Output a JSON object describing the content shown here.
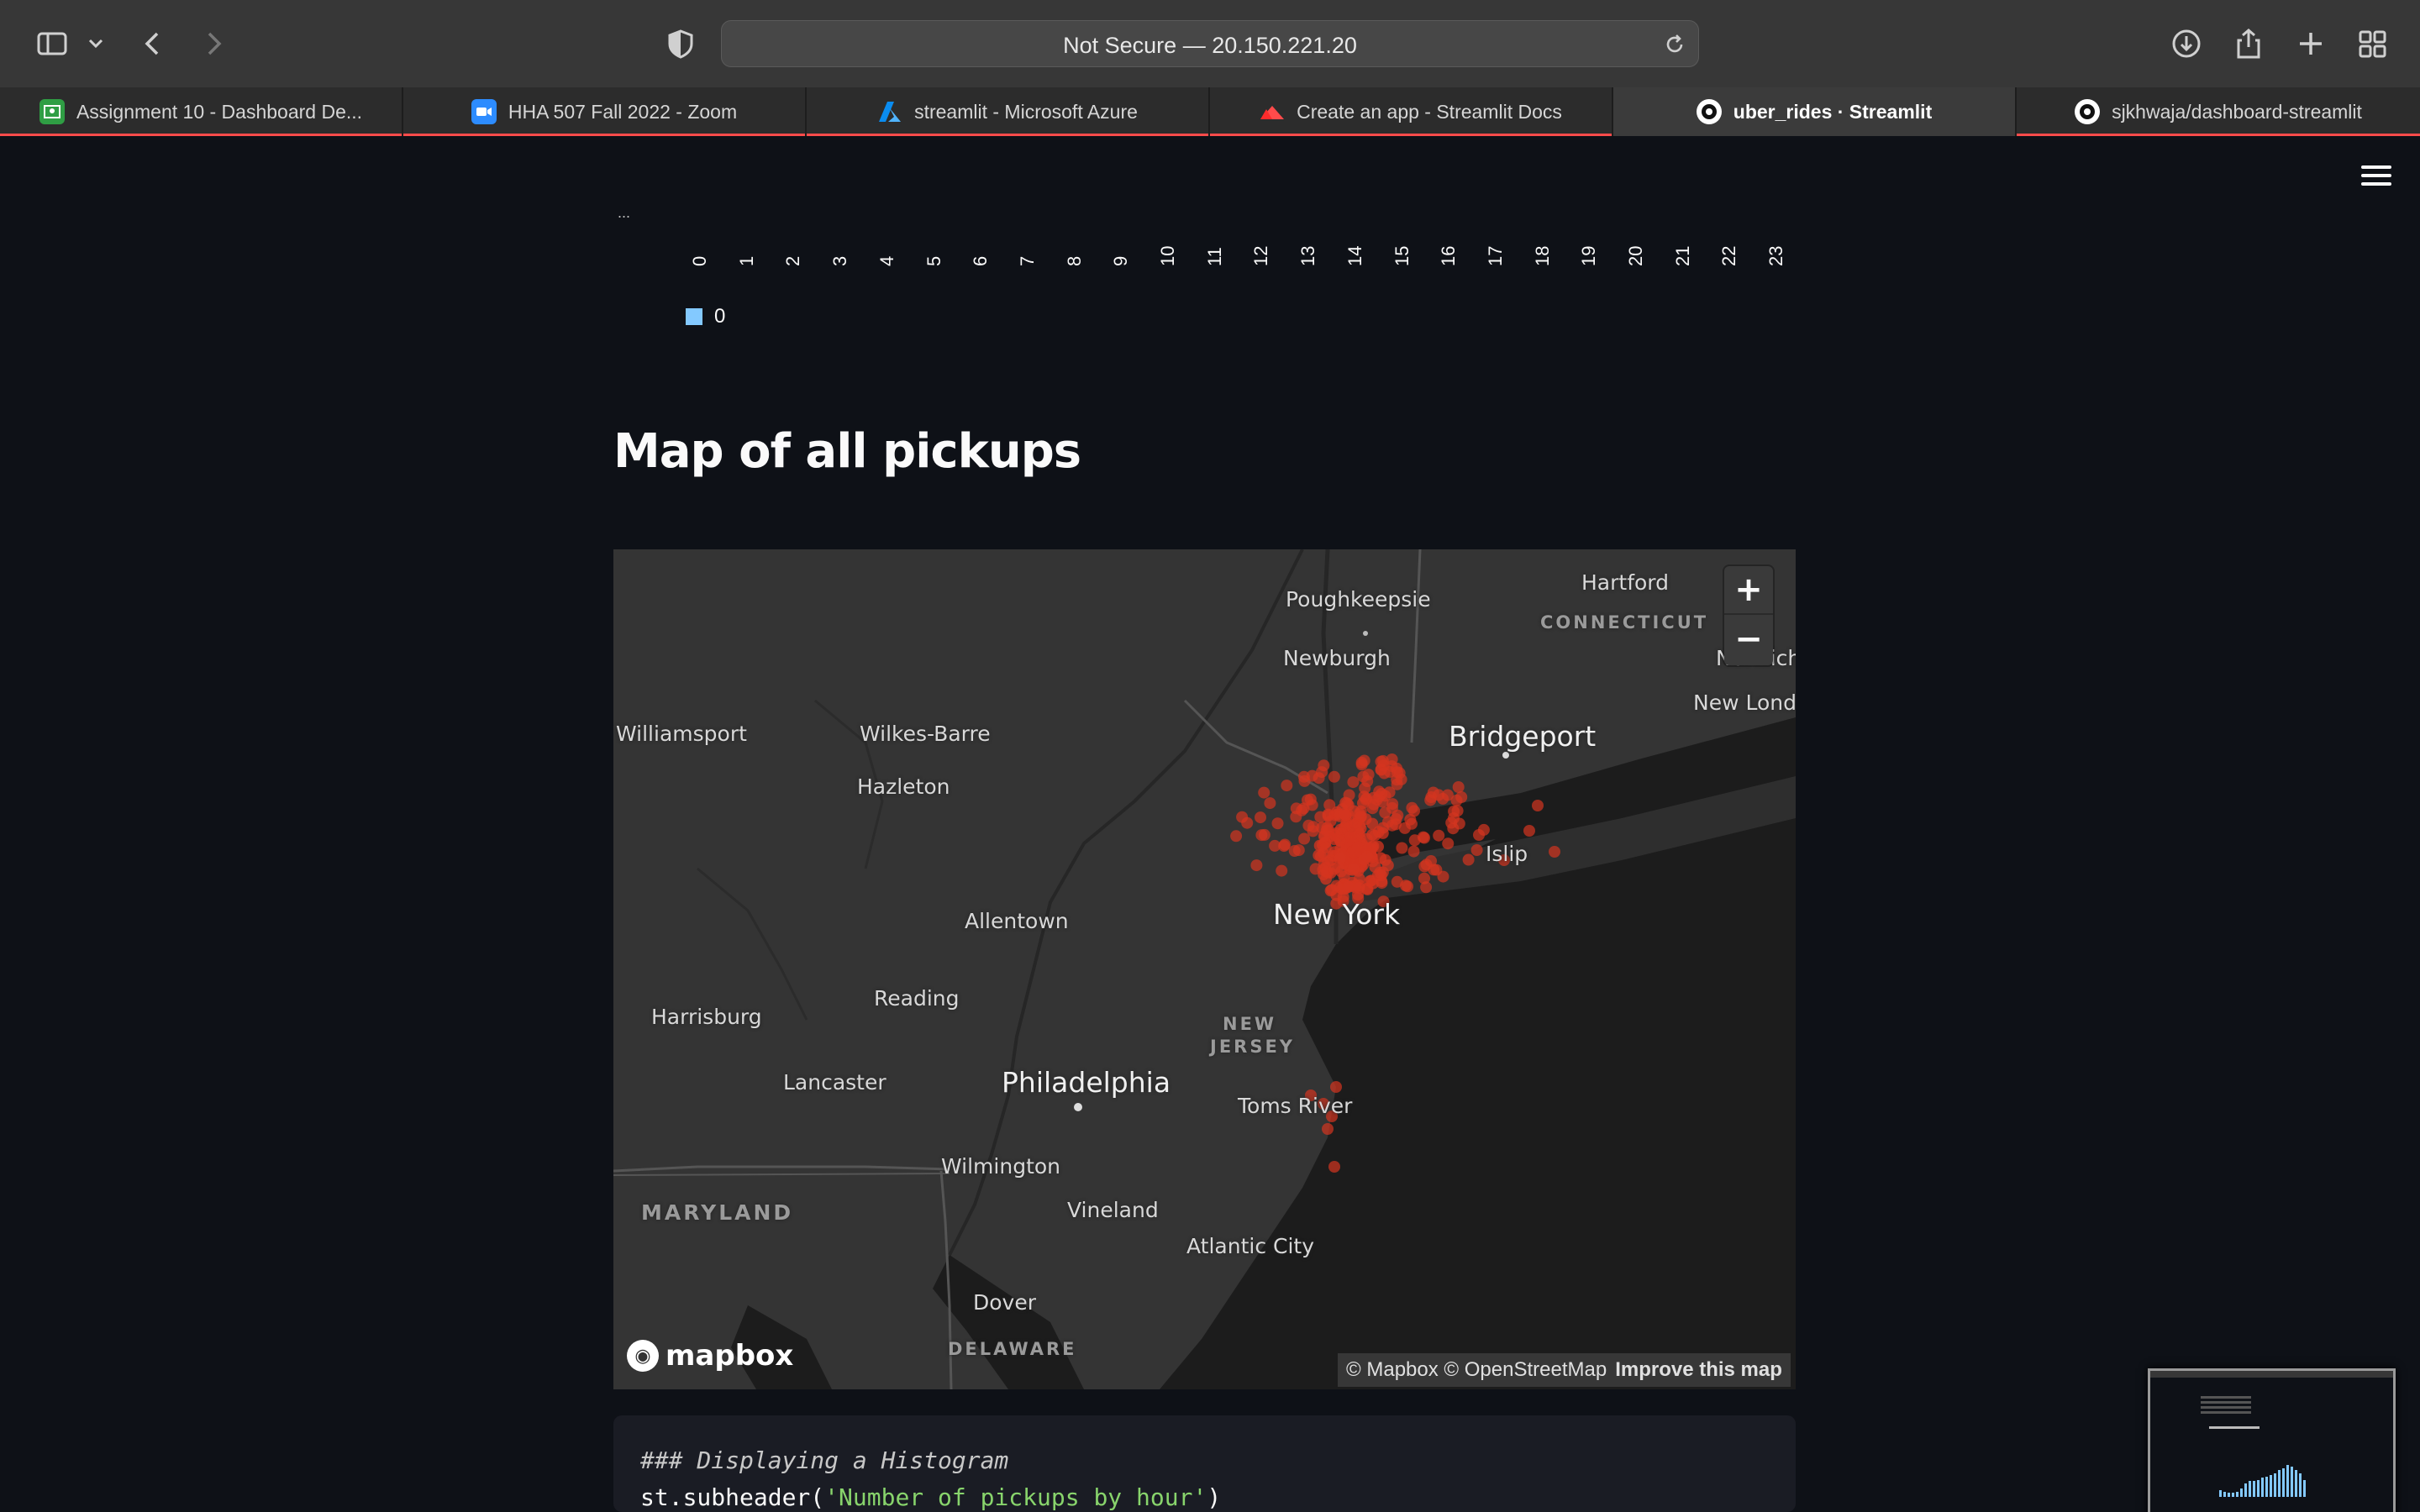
{
  "browser": {
    "url": "Not Secure — 20.150.221.20",
    "tabs": [
      {
        "label": "Assignment 10 - Dashboard De...",
        "icon": "classroom-icon",
        "color": "#2f9e44"
      },
      {
        "label": "HHA 507 Fall 2022 - Zoom",
        "icon": "zoom-icon",
        "color": "#2d8cff"
      },
      {
        "label": "streamlit - Microsoft Azure",
        "icon": "azure-icon",
        "color": "#0078d4"
      },
      {
        "label": "Create an app - Streamlit Docs",
        "icon": "streamlit-icon",
        "color": "#ff4b4b"
      },
      {
        "label": "uber_rides · Streamlit",
        "icon": "github-icon",
        "color": "#ffffff",
        "active": true
      },
      {
        "label": "sjkhwaja/dashboard-streamlit",
        "icon": "github-icon",
        "color": "#ffffff"
      }
    ]
  },
  "chart": {
    "cut_label": "...",
    "ticks": [
      "0",
      "1",
      "2",
      "3",
      "4",
      "5",
      "6",
      "7",
      "8",
      "9",
      "10",
      "11",
      "12",
      "13",
      "14",
      "15",
      "16",
      "17",
      "18",
      "19",
      "20",
      "21",
      "22",
      "23"
    ],
    "legend": "0",
    "legend_color": "#83c9ff"
  },
  "main": {
    "map_heading": "Map of all pickups"
  },
  "map": {
    "places": {
      "poughkeepsie": "Poughkeepsie",
      "hartford": "Hartford",
      "connecticut": "CONNECTICUT",
      "newburgh": "Newburgh",
      "norwich": "Norwich",
      "new_london": "New London",
      "williamsport": "Williamsport",
      "wilkes_barre": "Wilkes-Barre",
      "bridgeport": "Bridgeport",
      "hazleton": "Hazleton",
      "islip": "Islip",
      "allentown": "Allentown",
      "new_york": "New York",
      "reading": "Reading",
      "harrisburg": "Harrisburg",
      "new_jersey_1": "NEW",
      "new_jersey_2": "JERSEY",
      "lancaster": "Lancaster",
      "philadelphia": "Philadelphia",
      "toms_river": "Toms River",
      "wilmington": "Wilmington",
      "maryland": "MARYLAND",
      "vineland": "Vineland",
      "atlantic_city": "Atlantic City",
      "dover": "Dover",
      "delaware": "DELAWARE"
    },
    "zoom_in": "+",
    "zoom_out": "−",
    "logo": "mapbox",
    "attribution": "© Mapbox © OpenStreetMap",
    "improve": "Improve this map",
    "point_color": "#d4341f"
  },
  "code": {
    "comment": "### Displaying a Histogram",
    "fn": "st.subheader(",
    "str": "'Number of pickups by hour'",
    "close": ")"
  }
}
